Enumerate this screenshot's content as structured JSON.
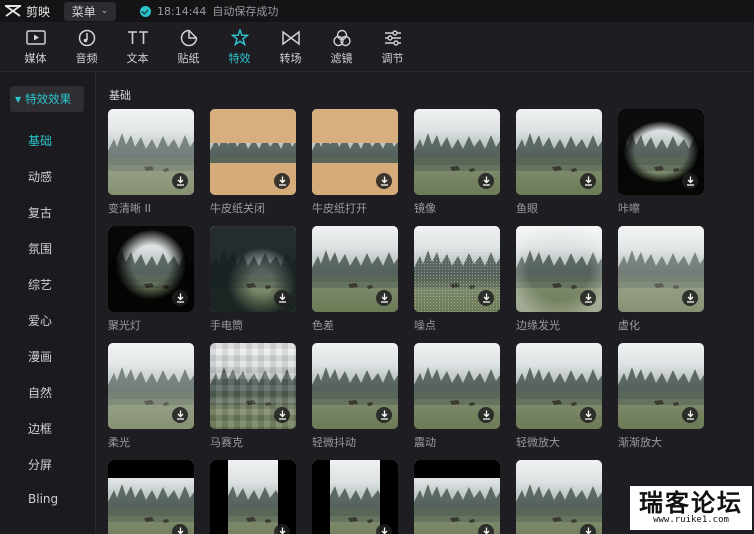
{
  "app": {
    "title": "剪映",
    "menu_label": "菜单"
  },
  "status": {
    "time": "18:14:44",
    "text": "自动保存成功"
  },
  "toolbar": {
    "tabs": [
      {
        "label": "媒体",
        "icon": "media-icon"
      },
      {
        "label": "音频",
        "icon": "audio-icon"
      },
      {
        "label": "文本",
        "icon": "text-icon"
      },
      {
        "label": "贴纸",
        "icon": "sticker-icon"
      },
      {
        "label": "特效",
        "icon": "effects-icon",
        "active": true
      },
      {
        "label": "转场",
        "icon": "transition-icon"
      },
      {
        "label": "滤镜",
        "icon": "filter-icon"
      },
      {
        "label": "调节",
        "icon": "adjust-icon"
      }
    ]
  },
  "sidebar": {
    "header": "特效效果",
    "items": [
      "基础",
      "动感",
      "复古",
      "氛围",
      "综艺",
      "爱心",
      "漫画",
      "自然",
      "边框",
      "分屏",
      "Bling"
    ],
    "active_index": 0
  },
  "main": {
    "section_title": "基础",
    "effects": [
      {
        "label": "变清晰 II",
        "style": "blurry"
      },
      {
        "label": "牛皮纸关闭",
        "style": "paper"
      },
      {
        "label": "牛皮纸打开",
        "style": "paper"
      },
      {
        "label": "镜像",
        "style": "normal"
      },
      {
        "label": "鱼眼",
        "style": "normal"
      },
      {
        "label": "咔嚓",
        "style": "vignette"
      },
      {
        "label": "聚光灯",
        "style": "spot"
      },
      {
        "label": "手电筒",
        "style": "torch"
      },
      {
        "label": "色差",
        "style": "normal"
      },
      {
        "label": "噪点",
        "style": "noise"
      },
      {
        "label": "边缘发光",
        "style": "glow"
      },
      {
        "label": "虚化",
        "style": "blurry"
      },
      {
        "label": "柔光",
        "style": "blurry"
      },
      {
        "label": "马赛克",
        "style": "mosaic"
      },
      {
        "label": "轻微抖动",
        "style": "normal"
      },
      {
        "label": "震动",
        "style": "normal"
      },
      {
        "label": "轻微放大",
        "style": "normal"
      },
      {
        "label": "渐渐放大",
        "style": "normal"
      },
      {
        "label": "",
        "style": "bartop"
      },
      {
        "label": "",
        "style": "bars"
      },
      {
        "label": "",
        "style": "bars"
      },
      {
        "label": "",
        "style": "bartop"
      },
      {
        "label": "",
        "style": "normal"
      }
    ]
  },
  "watermark": {
    "title": "瑞客论坛",
    "url": "www.ruike1.com"
  },
  "colors": {
    "accent": "#2cc6cf",
    "bg": "#1e1e22",
    "topbar": "#141417"
  }
}
